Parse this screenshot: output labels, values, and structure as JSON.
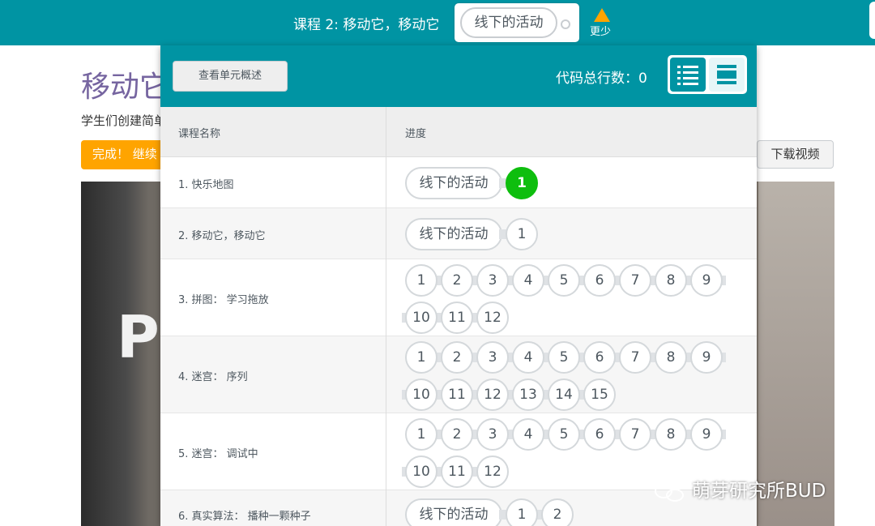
{
  "topbar": {
    "lesson_title": "课程 2: 移动它，移动它",
    "current_level_label": "线下的活动",
    "fewer_label": "更少"
  },
  "background": {
    "title": "移动它",
    "description": "学生们创建简单",
    "done_label": "完成！ 继续",
    "download_label": "下载视频",
    "video_letter": "P"
  },
  "panel": {
    "overview_button": "查看单元概述",
    "lines_of_code_label": "代码总行数：0",
    "view_detail_icon": "list-detail-icon",
    "view_summary_icon": "list-summary-icon",
    "col_lesson": "课程名称",
    "col_progress": "进度",
    "rows": [
      {
        "name": "1. 快乐地图",
        "pill": "线下的活动",
        "levels": [
          "1"
        ],
        "completed": [
          "1"
        ]
      },
      {
        "name": "2. 移动它，移动它",
        "pill": "线下的活动",
        "levels": [
          "1"
        ],
        "completed": []
      },
      {
        "name": "3. 拼图： 学习拖放",
        "levels": [
          "1",
          "2",
          "3",
          "4",
          "5",
          "6",
          "7",
          "8",
          "9",
          "10",
          "11",
          "12"
        ],
        "completed": []
      },
      {
        "name": "4. 迷宫： 序列",
        "levels": [
          "1",
          "2",
          "3",
          "4",
          "5",
          "6",
          "7",
          "8",
          "9",
          "10",
          "11",
          "12",
          "13",
          "14",
          "15"
        ],
        "completed": []
      },
      {
        "name": "5. 迷宫： 调试中",
        "levels": [
          "1",
          "2",
          "3",
          "4",
          "5",
          "6",
          "7",
          "8",
          "9",
          "10",
          "11",
          "12"
        ],
        "completed": []
      },
      {
        "name": "6. 真实算法： 播种一颗种子",
        "pill": "线下的活动",
        "levels": [
          "1",
          "2"
        ],
        "completed": []
      }
    ],
    "colors": {
      "accent": "#0094a3",
      "complete": "#0ebe0e",
      "orange": "#ffa400"
    }
  },
  "watermark": {
    "text": "萌芽研究所BUD",
    "icon": "wechat-icon"
  }
}
